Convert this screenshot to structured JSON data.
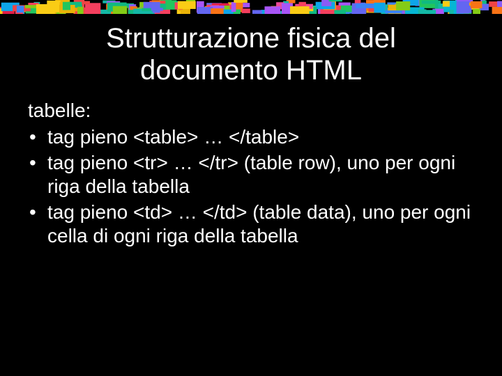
{
  "slide": {
    "title": "Strutturazione fisica del documento HTML",
    "lead": "tabelle:",
    "bullets": [
      "tag pieno <table> … </table>",
      "tag pieno <tr> … </tr> (table row), uno per ogni riga della tabella",
      "tag pieno <td> … </td> (table data), uno per ogni cella di ogni riga della tabella"
    ]
  },
  "decor": {
    "bar_colors": [
      "#e11d48",
      "#f97316",
      "#facc15",
      "#22c55e",
      "#06b6d4",
      "#3b82f6",
      "#8b5cf6",
      "#ec4899",
      "#f43f5e",
      "#10b981",
      "#eab308",
      "#0ea5e9",
      "#a855f7",
      "#14b8a6",
      "#f59e0b",
      "#ef4444",
      "#84cc16",
      "#6366f1"
    ]
  }
}
